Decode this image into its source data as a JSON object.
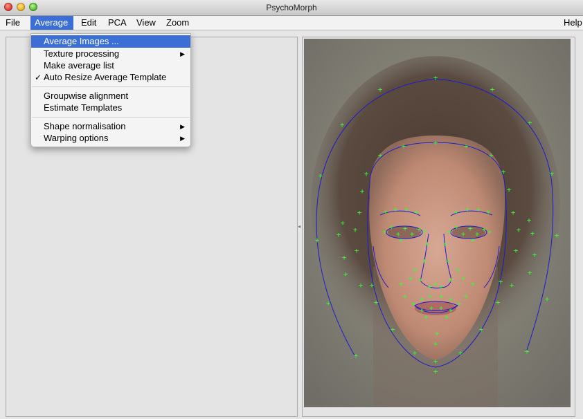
{
  "window": {
    "title": "PsychoMorph"
  },
  "menubar": {
    "file": "File",
    "average": "Average",
    "edit": "Edit",
    "pca": "PCA",
    "view": "View",
    "zoom": "Zoom",
    "help": "Help"
  },
  "average_menu": {
    "items": [
      {
        "label": "Average Images ...",
        "highlighted": true
      },
      {
        "label": "Texture processing",
        "submenu": true
      },
      {
        "label": "Make average list"
      },
      {
        "label": "Auto Resize Average Template",
        "checked": true
      },
      {
        "label": "Groupwise alignment"
      },
      {
        "label": "Estimate Templates"
      },
      {
        "label": "Shape normalisation",
        "submenu": true
      },
      {
        "label": "Warping options",
        "submenu": true
      }
    ],
    "checkmark": "✓",
    "arrow": "▶"
  },
  "image": {
    "contour_color": "#1c1ccc",
    "landmark_color": "#33ff33",
    "landmark_glyph": "+"
  }
}
